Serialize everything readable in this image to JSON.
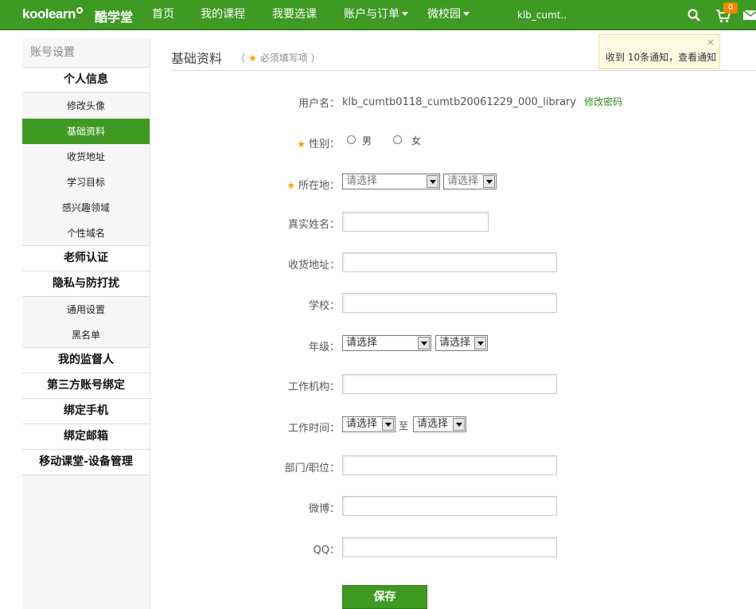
{
  "header": {
    "logo_text": "koolearn",
    "logo_cn": "酷学堂",
    "nav": [
      {
        "label": "首页",
        "dropdown": false
      },
      {
        "label": "我的课程",
        "dropdown": false
      },
      {
        "label": "我要选课",
        "dropdown": false
      },
      {
        "label": "账户与订单",
        "dropdown": true
      },
      {
        "label": "微校园",
        "dropdown": true
      }
    ],
    "user": "klb_cumt..",
    "cart_count": "0",
    "icons": [
      "search-icon",
      "cart-icon",
      "mail-icon"
    ],
    "bg_color": "#3f9a24"
  },
  "notice": {
    "text": "收到  10条通知，查看通知",
    "close": "×"
  },
  "sidebar": {
    "header": "账号设置",
    "categories": [
      {
        "label": "个人信息",
        "items": [
          "修改头像",
          "基础资料",
          "收货地址",
          "学习目标",
          "感兴趣领域",
          "个性域名"
        ]
      },
      {
        "label": "老师认证",
        "items": []
      },
      {
        "label": "隐私与防打扰",
        "items": [
          "通用设置",
          "黑名单"
        ]
      },
      {
        "label": "我的监督人",
        "items": []
      },
      {
        "label": "第三方账号绑定",
        "items": []
      },
      {
        "label": "绑定手机",
        "items": []
      },
      {
        "label": "绑定邮箱",
        "items": []
      },
      {
        "label": "移动课堂-设备管理",
        "items": []
      }
    ],
    "active_item": "基础资料",
    "active_color": "#3f9a24"
  },
  "main": {
    "title": "基础资料",
    "required_note_open": "（",
    "required_note_star": "★",
    "required_note_text": "必须填写项",
    "required_note_close": "）",
    "form": {
      "username": {
        "label": "用户名：",
        "value": "klb_cumtb0118_cumtb20061229_000_library",
        "link": "修改密码"
      },
      "gender": {
        "label": "性别：",
        "required": true,
        "options": [
          "男",
          "女"
        ]
      },
      "location": {
        "label": "所在地：",
        "required": true,
        "select1": "请选择",
        "select2": "请选择"
      },
      "realname": {
        "label": "真实姓名：",
        "value": ""
      },
      "address": {
        "label": "收货地址：",
        "value": ""
      },
      "school": {
        "label": "学校：",
        "value": ""
      },
      "grade": {
        "label": "年级：",
        "select1": "请选择",
        "select2": "请选择"
      },
      "org": {
        "label": "工作机构：",
        "value": ""
      },
      "worktime": {
        "label": "工作时间：",
        "select1": "请选择",
        "to": "至",
        "select2": "请选择"
      },
      "dept": {
        "label": "部门/职位：",
        "value": ""
      },
      "weibo": {
        "label": "微博：",
        "value": ""
      },
      "qq": {
        "label": "QQ：",
        "value": ""
      }
    },
    "save_label": "保存"
  }
}
